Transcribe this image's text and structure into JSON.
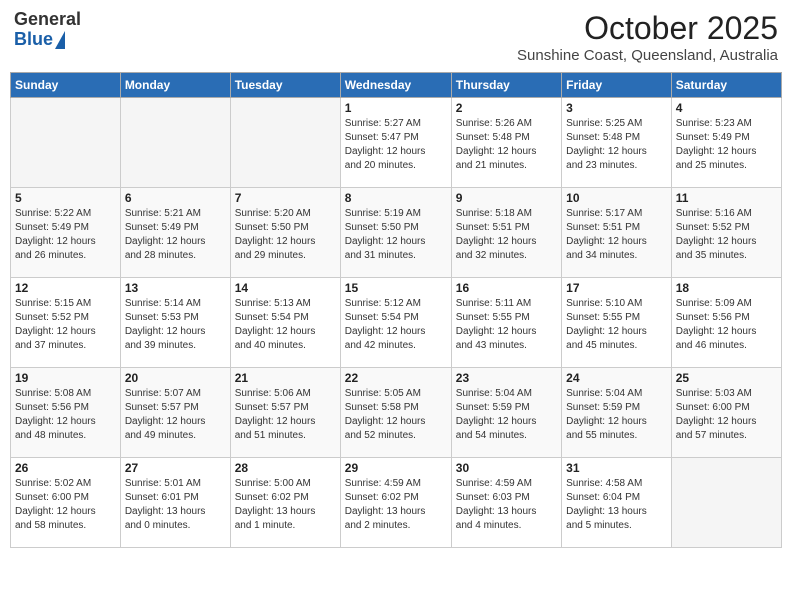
{
  "header": {
    "logo_general": "General",
    "logo_blue": "Blue",
    "month_title": "October 2025",
    "location": "Sunshine Coast, Queensland, Australia"
  },
  "calendar": {
    "days_of_week": [
      "Sunday",
      "Monday",
      "Tuesday",
      "Wednesday",
      "Thursday",
      "Friday",
      "Saturday"
    ],
    "weeks": [
      [
        {
          "day": "",
          "info": ""
        },
        {
          "day": "",
          "info": ""
        },
        {
          "day": "",
          "info": ""
        },
        {
          "day": "1",
          "info": "Sunrise: 5:27 AM\nSunset: 5:47 PM\nDaylight: 12 hours\nand 20 minutes."
        },
        {
          "day": "2",
          "info": "Sunrise: 5:26 AM\nSunset: 5:48 PM\nDaylight: 12 hours\nand 21 minutes."
        },
        {
          "day": "3",
          "info": "Sunrise: 5:25 AM\nSunset: 5:48 PM\nDaylight: 12 hours\nand 23 minutes."
        },
        {
          "day": "4",
          "info": "Sunrise: 5:23 AM\nSunset: 5:49 PM\nDaylight: 12 hours\nand 25 minutes."
        }
      ],
      [
        {
          "day": "5",
          "info": "Sunrise: 5:22 AM\nSunset: 5:49 PM\nDaylight: 12 hours\nand 26 minutes."
        },
        {
          "day": "6",
          "info": "Sunrise: 5:21 AM\nSunset: 5:49 PM\nDaylight: 12 hours\nand 28 minutes."
        },
        {
          "day": "7",
          "info": "Sunrise: 5:20 AM\nSunset: 5:50 PM\nDaylight: 12 hours\nand 29 minutes."
        },
        {
          "day": "8",
          "info": "Sunrise: 5:19 AM\nSunset: 5:50 PM\nDaylight: 12 hours\nand 31 minutes."
        },
        {
          "day": "9",
          "info": "Sunrise: 5:18 AM\nSunset: 5:51 PM\nDaylight: 12 hours\nand 32 minutes."
        },
        {
          "day": "10",
          "info": "Sunrise: 5:17 AM\nSunset: 5:51 PM\nDaylight: 12 hours\nand 34 minutes."
        },
        {
          "day": "11",
          "info": "Sunrise: 5:16 AM\nSunset: 5:52 PM\nDaylight: 12 hours\nand 35 minutes."
        }
      ],
      [
        {
          "day": "12",
          "info": "Sunrise: 5:15 AM\nSunset: 5:52 PM\nDaylight: 12 hours\nand 37 minutes."
        },
        {
          "day": "13",
          "info": "Sunrise: 5:14 AM\nSunset: 5:53 PM\nDaylight: 12 hours\nand 39 minutes."
        },
        {
          "day": "14",
          "info": "Sunrise: 5:13 AM\nSunset: 5:54 PM\nDaylight: 12 hours\nand 40 minutes."
        },
        {
          "day": "15",
          "info": "Sunrise: 5:12 AM\nSunset: 5:54 PM\nDaylight: 12 hours\nand 42 minutes."
        },
        {
          "day": "16",
          "info": "Sunrise: 5:11 AM\nSunset: 5:55 PM\nDaylight: 12 hours\nand 43 minutes."
        },
        {
          "day": "17",
          "info": "Sunrise: 5:10 AM\nSunset: 5:55 PM\nDaylight: 12 hours\nand 45 minutes."
        },
        {
          "day": "18",
          "info": "Sunrise: 5:09 AM\nSunset: 5:56 PM\nDaylight: 12 hours\nand 46 minutes."
        }
      ],
      [
        {
          "day": "19",
          "info": "Sunrise: 5:08 AM\nSunset: 5:56 PM\nDaylight: 12 hours\nand 48 minutes."
        },
        {
          "day": "20",
          "info": "Sunrise: 5:07 AM\nSunset: 5:57 PM\nDaylight: 12 hours\nand 49 minutes."
        },
        {
          "day": "21",
          "info": "Sunrise: 5:06 AM\nSunset: 5:57 PM\nDaylight: 12 hours\nand 51 minutes."
        },
        {
          "day": "22",
          "info": "Sunrise: 5:05 AM\nSunset: 5:58 PM\nDaylight: 12 hours\nand 52 minutes."
        },
        {
          "day": "23",
          "info": "Sunrise: 5:04 AM\nSunset: 5:59 PM\nDaylight: 12 hours\nand 54 minutes."
        },
        {
          "day": "24",
          "info": "Sunrise: 5:04 AM\nSunset: 5:59 PM\nDaylight: 12 hours\nand 55 minutes."
        },
        {
          "day": "25",
          "info": "Sunrise: 5:03 AM\nSunset: 6:00 PM\nDaylight: 12 hours\nand 57 minutes."
        }
      ],
      [
        {
          "day": "26",
          "info": "Sunrise: 5:02 AM\nSunset: 6:00 PM\nDaylight: 12 hours\nand 58 minutes."
        },
        {
          "day": "27",
          "info": "Sunrise: 5:01 AM\nSunset: 6:01 PM\nDaylight: 13 hours\nand 0 minutes."
        },
        {
          "day": "28",
          "info": "Sunrise: 5:00 AM\nSunset: 6:02 PM\nDaylight: 13 hours\nand 1 minute."
        },
        {
          "day": "29",
          "info": "Sunrise: 4:59 AM\nSunset: 6:02 PM\nDaylight: 13 hours\nand 2 minutes."
        },
        {
          "day": "30",
          "info": "Sunrise: 4:59 AM\nSunset: 6:03 PM\nDaylight: 13 hours\nand 4 minutes."
        },
        {
          "day": "31",
          "info": "Sunrise: 4:58 AM\nSunset: 6:04 PM\nDaylight: 13 hours\nand 5 minutes."
        },
        {
          "day": "",
          "info": ""
        }
      ]
    ]
  }
}
